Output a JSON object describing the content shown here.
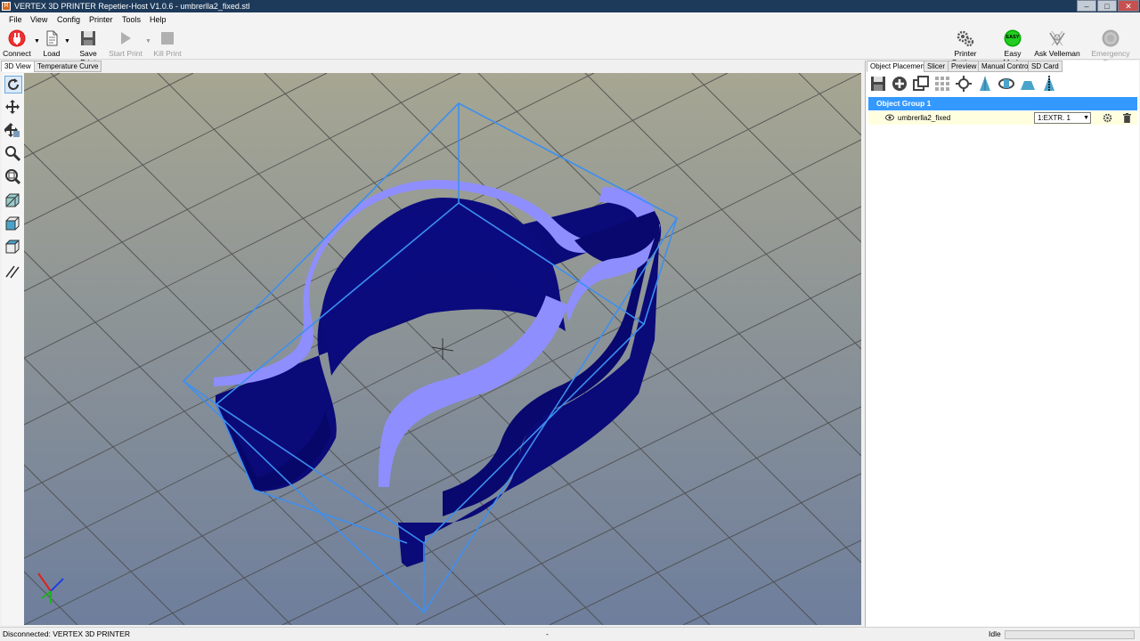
{
  "window": {
    "title": "VERTEX 3D PRINTER Repetier-Host V1.0.6 - umbrerlla2_fixed.stl",
    "app_icon_letter": "R"
  },
  "menu": [
    "File",
    "View",
    "Config",
    "Printer",
    "Tools",
    "Help"
  ],
  "toolbar": {
    "left": [
      {
        "label": "Connect",
        "icon": "power-plug-icon"
      },
      {
        "label": "Load",
        "icon": "document-icon"
      },
      {
        "label": "Save Print",
        "icon": "save-icon"
      },
      {
        "label": "Start Print",
        "icon": "play-icon",
        "disabled": true
      },
      {
        "label": "Kill Print",
        "icon": "stop-icon",
        "disabled": true
      }
    ],
    "right": [
      {
        "label": "Printer Settings",
        "icon": "gears-icon"
      },
      {
        "label": "Easy Mode",
        "icon": "easy-badge-icon",
        "badge": "EASY"
      },
      {
        "label": "Ask Velleman",
        "icon": "velleman-logo-icon"
      },
      {
        "label": "Emergency Stop",
        "icon": "emergency-stop-icon",
        "disabled": true
      }
    ]
  },
  "view_tabs": [
    "3D View",
    "Temperature Curve"
  ],
  "view_tools": [
    "rotate-icon",
    "move-icon",
    "move-object-icon",
    "zoom-icon",
    "fit-view-icon",
    "iso-view-icon",
    "front-view-icon",
    "top-view-icon",
    "parallel-projection-icon"
  ],
  "right_tabs": [
    "Object Placement",
    "Slicer",
    "Preview",
    "Manual Control",
    "SD Card"
  ],
  "object_tools": [
    "save-icon",
    "add-object-icon",
    "copy-object-icon",
    "autoposition-icon",
    "center-object-icon",
    "drop-object-icon",
    "rotate-object-icon",
    "scale-object-icon",
    "cut-object-icon"
  ],
  "object_list": {
    "group": "Object Group 1",
    "items": [
      {
        "name": "umbrerlla2_fixed",
        "extruder": "1:EXTR. 1"
      }
    ]
  },
  "status": {
    "left": "Disconnected: VERTEX 3D PRINTER",
    "middle": "-",
    "right": "Idle"
  },
  "colors": {
    "titlebar": "#1e3a5a",
    "selection": "#3399ff",
    "bounding_box": "#3d8ff0",
    "model_top": "#8e8eff",
    "model_side": "#0a0a78",
    "grid": "#4b4b4b",
    "row_highlight": "#ffffe0"
  }
}
